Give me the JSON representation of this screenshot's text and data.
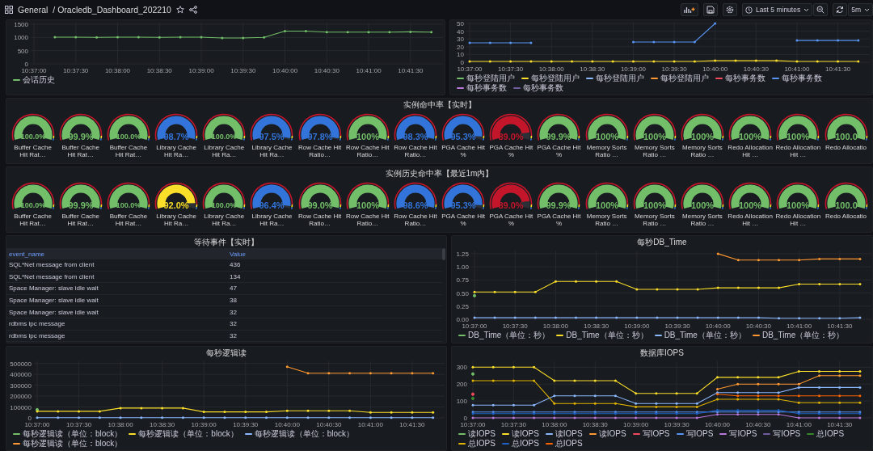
{
  "top_bar": {
    "folder": "General",
    "dashboard": "/ Oracledb_Dashboard_202210",
    "time_range": "Last 5 minutes",
    "refresh_interval": "5m"
  },
  "session_chart": {
    "chart_data": {
      "type": "line",
      "categories": [
        "10:37:00",
        null,
        "10:37:30",
        null,
        "10:38:00",
        null,
        "10:38:30",
        null,
        "10:39:00",
        null,
        "10:39:30",
        null,
        "10:40:00",
        null,
        "10:40:30",
        null,
        "10:41:00",
        null,
        "10:41:30",
        null
      ],
      "ylim": [
        0,
        1560
      ],
      "yticks": [
        0,
        500,
        1000,
        1500
      ],
      "grid": true,
      "legend": "bottom",
      "series": [
        {
          "name": "会话历史",
          "color": "#73bf69",
          "marker": true,
          "values": [
            null,
            1010,
            1010,
            1000,
            1010,
            1010,
            1000,
            1010,
            1010,
            980,
            980,
            1000,
            1240,
            1240,
            1200,
            1200,
            1200,
            1200,
            1210,
            1200
          ]
        }
      ]
    }
  },
  "rate_chart": {
    "chart_data": {
      "type": "line",
      "categories": [
        "10:37:00",
        null,
        "10:37:30",
        null,
        "10:38:00",
        null,
        "10:38:30",
        null,
        "10:39:00",
        null,
        "10:39:30",
        null,
        "10:40:00",
        null,
        "10:40:30",
        null,
        "10:41:00",
        null,
        "10:41:30",
        null
      ],
      "ylim": [
        0,
        51
      ],
      "yticks": [
        0,
        10,
        20,
        30,
        40,
        50
      ],
      "grid": true,
      "legend": "bottom",
      "series": [
        {
          "name": "每秒登陆用户",
          "color": "#73bf69",
          "marker": true,
          "values": [
            null,
            null,
            null,
            null,
            null,
            null,
            null,
            null,
            null,
            null,
            null,
            null,
            null,
            null,
            null,
            null,
            null,
            null,
            null,
            null
          ]
        },
        {
          "name": "每秒登陆用户",
          "color": "#fade2a",
          "marker": true,
          "values": [
            1,
            1,
            1,
            1,
            1,
            1,
            1,
            1,
            1,
            1,
            1,
            1,
            2,
            2,
            2,
            2,
            1,
            1,
            1,
            1
          ]
        },
        {
          "name": "每秒登陆用户",
          "color": "#8ab8ff",
          "marker": true,
          "values": [
            null,
            null,
            null,
            null,
            null,
            null,
            null,
            null,
            null,
            null,
            null,
            null,
            null,
            null,
            null,
            null,
            null,
            null,
            null,
            null
          ]
        },
        {
          "name": "每秒登陆用户",
          "color": "#ff9830",
          "marker": true,
          "values": [
            null,
            null,
            null,
            null,
            null,
            null,
            null,
            null,
            null,
            null,
            null,
            null,
            null,
            null,
            null,
            null,
            null,
            null,
            null,
            null
          ]
        },
        {
          "name": "每秒事务数",
          "color": "#f2495c",
          "marker": true,
          "values": [
            null,
            null,
            null,
            null,
            null,
            null,
            null,
            null,
            null,
            null,
            null,
            null,
            null,
            null,
            null,
            null,
            null,
            null,
            null,
            null
          ]
        },
        {
          "name": "每秒事务数",
          "color": "#5794f2",
          "marker": true,
          "values": [
            25,
            25,
            25,
            25,
            null,
            null,
            null,
            null,
            26,
            26,
            26,
            26,
            50,
            null,
            null,
            null,
            28,
            28,
            28,
            28
          ]
        },
        {
          "name": "每秒事务数",
          "color": "#b877d9",
          "marker": true,
          "values": [
            null,
            null,
            null,
            null,
            null,
            null,
            null,
            null,
            null,
            null,
            null,
            null,
            null,
            null,
            null,
            null,
            null,
            null,
            null,
            null
          ]
        },
        {
          "name": "每秒事务数",
          "color": "#705da0",
          "marker": true,
          "values": [
            null,
            null,
            null,
            null,
            null,
            null,
            null,
            null,
            null,
            null,
            null,
            null,
            null,
            null,
            null,
            null,
            null,
            null,
            null,
            null
          ]
        }
      ]
    }
  },
  "gauge_panels": [
    {
      "title": "实例命中率【实时】",
      "gauges": [
        {
          "label": "Buffer Cache Hit Rat…",
          "value": "100.0%",
          "color": "#73bf69"
        },
        {
          "label": "Buffer Cache Hit Rat…",
          "value": "99.9%",
          "color": "#73bf69"
        },
        {
          "label": "Buffer Cache Hit Rat…",
          "value": "100.0%",
          "color": "#73bf69"
        },
        {
          "label": "Library Cache Hit Ra…",
          "value": "98.7%",
          "color": "#3274d9"
        },
        {
          "label": "Library Cache Hit Ra…",
          "value": "100.0%",
          "color": "#73bf69"
        },
        {
          "label": "Library Cache Hit Ra…",
          "value": "97.5%",
          "color": "#3274d9"
        },
        {
          "label": "Row Cache Hit Ratio…",
          "value": "97.8%",
          "color": "#3274d9"
        },
        {
          "label": "Row Cache Hit Ratio…",
          "value": "100%",
          "color": "#73bf69"
        },
        {
          "label": "Row Cache Hit Ratio…",
          "value": "98.3%",
          "color": "#3274d9"
        },
        {
          "label": "PGA Cache Hit %",
          "value": "95.3%",
          "color": "#3274d9"
        },
        {
          "label": "PGA Cache Hit %",
          "value": "89.0%",
          "color": "#c4162a"
        },
        {
          "label": "PGA Cache Hit %",
          "value": "99.9%",
          "color": "#73bf69"
        },
        {
          "label": "Memory Sorts Ratio …",
          "value": "100%",
          "color": "#73bf69"
        },
        {
          "label": "Memory Sorts Ratio …",
          "value": "100%",
          "color": "#73bf69"
        },
        {
          "label": "Memory Sorts Ratio …",
          "value": "100%",
          "color": "#73bf69"
        },
        {
          "label": "Redo Allocation Hit …",
          "value": "100%",
          "color": "#73bf69"
        },
        {
          "label": "Redo Allocation Hit …",
          "value": "100%",
          "color": "#73bf69"
        },
        {
          "label": "Redo Allocatio",
          "value": "100.0",
          "color": "#73bf69"
        }
      ]
    },
    {
      "title": "实例历史命中率【最近1m内】",
      "gauges": [
        {
          "label": "Buffer Cache Hit Rat…",
          "value": "100.0%",
          "color": "#73bf69"
        },
        {
          "label": "Buffer Cache Hit Rat…",
          "value": "99.9%",
          "color": "#73bf69"
        },
        {
          "label": "Buffer Cache Hit Rat…",
          "value": "100.0%",
          "color": "#73bf69"
        },
        {
          "label": "Library Cache Hit Ra…",
          "value": "92.0%",
          "color": "#fade2a"
        },
        {
          "label": "Library Cache Hit Ra…",
          "value": "100.0%",
          "color": "#73bf69"
        },
        {
          "label": "Library Cache Hit Ra…",
          "value": "96.4%",
          "color": "#3274d9"
        },
        {
          "label": "Row Cache Hit Ratio…",
          "value": "99.0%",
          "color": "#73bf69"
        },
        {
          "label": "Row Cache Hit Ratio…",
          "value": "100%",
          "color": "#73bf69"
        },
        {
          "label": "Row Cache Hit Ratio…",
          "value": "98.6%",
          "color": "#3274d9"
        },
        {
          "label": "PGA Cache Hit %",
          "value": "95.3%",
          "color": "#3274d9"
        },
        {
          "label": "PGA Cache Hit %",
          "value": "89.0%",
          "color": "#c4162a"
        },
        {
          "label": "PGA Cache Hit %",
          "value": "99.9%",
          "color": "#73bf69"
        },
        {
          "label": "Memory Sorts Ratio …",
          "value": "100%",
          "color": "#73bf69"
        },
        {
          "label": "Memory Sorts Ratio …",
          "value": "100%",
          "color": "#73bf69"
        },
        {
          "label": "Memory Sorts Ratio …",
          "value": "100%",
          "color": "#73bf69"
        },
        {
          "label": "Redo Allocation Hit …",
          "value": "100%",
          "color": "#73bf69"
        },
        {
          "label": "Redo Allocation Hit …",
          "value": "100%",
          "color": "#73bf69"
        },
        {
          "label": "Redo Allocatio",
          "value": "100.0",
          "color": "#73bf69"
        }
      ]
    }
  ],
  "wait_events": {
    "title": "等待事件【实时】",
    "columns": [
      "event_name",
      "Value"
    ],
    "rows": [
      [
        "SQL*Net message from client",
        "436"
      ],
      [
        "SQL*Net message from client",
        "134"
      ],
      [
        "Space Manager: slave idle wait",
        "47"
      ],
      [
        "Space Manager: slave idle wait",
        "38"
      ],
      [
        "Space Manager: slave idle wait",
        "32"
      ],
      [
        "rdbms ipc message",
        "32"
      ],
      [
        "rdbms ipc message",
        "32"
      ]
    ]
  },
  "db_time": {
    "title": "每秒DB_Time",
    "chart_data": {
      "type": "line",
      "categories": [
        "10:37:00",
        null,
        "10:37:30",
        null,
        "10:38:00",
        null,
        "10:38:30",
        null,
        "10:39:00",
        null,
        "10:39:30",
        null,
        "10:40:00",
        null,
        "10:40:30",
        null,
        "10:41:00",
        null,
        "10:41:30",
        null
      ],
      "ylim": [
        0,
        1.31
      ],
      "yticks": [
        {
          "value": 0,
          "label": "0.00"
        },
        {
          "value": 0.25,
          "label": "0.25"
        },
        {
          "value": 0.5,
          "label": "0.50"
        },
        {
          "value": 0.75,
          "label": "0.75"
        },
        {
          "value": 1,
          "label": "1.00"
        },
        {
          "value": 1.25,
          "label": "1.25"
        }
      ],
      "grid": true,
      "legend": "bottom",
      "series": [
        {
          "name": "DB_Time（单位：秒）",
          "color": "#73bf69",
          "marker": true,
          "values": [
            0.45,
            null,
            null,
            null,
            null,
            null,
            null,
            null,
            null,
            null,
            null,
            null,
            null,
            null,
            null,
            null,
            null,
            null,
            null,
            null
          ]
        },
        {
          "name": "DB_Time（单位：秒）",
          "color": "#fade2a",
          "marker": true,
          "values": [
            0.52,
            0.52,
            0.52,
            0.52,
            0.72,
            0.72,
            0.72,
            0.72,
            0.57,
            0.57,
            0.57,
            0.57,
            0.6,
            0.6,
            0.6,
            0.6,
            0.67,
            0.67,
            0.67,
            0.67
          ]
        },
        {
          "name": "DB_Time（单位：秒）",
          "color": "#8ab8ff",
          "marker": true,
          "values": [
            0.03,
            0.03,
            0.03,
            0.03,
            0.03,
            0.03,
            0.03,
            0.03,
            0.03,
            0.03,
            0.03,
            0.03,
            0.03,
            0.03,
            0.03,
            0.02,
            0.02,
            0.02,
            0.02,
            0.03
          ]
        },
        {
          "name": "DB_Time（单位：秒）",
          "color": "#ff9830",
          "marker": true,
          "values": [
            null,
            null,
            null,
            null,
            null,
            null,
            null,
            null,
            null,
            null,
            null,
            null,
            1.25,
            1.13,
            1.13,
            1.13,
            1.13,
            1.15,
            1.15,
            1.15
          ]
        }
      ]
    }
  },
  "logical_reads": {
    "title": "每秒逻辑读",
    "chart_data": {
      "type": "line",
      "categories": [
        "10:37:00",
        null,
        "10:37:30",
        null,
        "10:38:00",
        null,
        "10:38:30",
        null,
        "10:39:00",
        null,
        "10:39:30",
        null,
        "10:40:00",
        null,
        "10:40:30",
        null,
        "10:41:00",
        null,
        "10:41:30",
        null
      ],
      "ylim": [
        0,
        520000
      ],
      "yticks": [
        0,
        100000,
        200000,
        300000,
        400000,
        500000
      ],
      "grid": true,
      "legend": "bottom",
      "series": [
        {
          "name": "每秒逻辑读（单位：block）",
          "color": "#73bf69",
          "marker": true,
          "values": [
            75000,
            null,
            null,
            null,
            null,
            null,
            null,
            null,
            null,
            null,
            null,
            null,
            null,
            null,
            null,
            null,
            null,
            null,
            null,
            null
          ]
        },
        {
          "name": "每秒逻辑读（单位：block）",
          "color": "#fade2a",
          "marker": true,
          "values": [
            60000,
            60000,
            60000,
            60000,
            90000,
            90000,
            90000,
            90000,
            55000,
            55000,
            55000,
            55000,
            65000,
            65000,
            65000,
            65000,
            50000,
            50000,
            50000,
            50000
          ]
        },
        {
          "name": "每秒逻辑读（单位：block）",
          "color": "#8ab8ff",
          "marker": true,
          "values": [
            2000,
            2000,
            2000,
            2000,
            2000,
            2000,
            2000,
            2000,
            2000,
            2000,
            2000,
            2000,
            2000,
            2000,
            2000,
            2000,
            2000,
            2000,
            2000,
            2000
          ]
        },
        {
          "name": "每秒逻辑读（单位：block）",
          "color": "#ff9830",
          "marker": true,
          "values": [
            null,
            null,
            null,
            null,
            null,
            null,
            null,
            null,
            null,
            null,
            null,
            null,
            470000,
            410000,
            410000,
            410000,
            410000,
            410000,
            410000,
            410000
          ]
        }
      ]
    }
  },
  "iops": {
    "title": "数据库IOPS",
    "chart_data": {
      "type": "line",
      "categories": [
        "10:37:00",
        null,
        "10:37:30",
        null,
        "10:38:00",
        null,
        "10:38:30",
        null,
        "10:39:00",
        null,
        "10:39:30",
        null,
        "10:40:00",
        null,
        "10:40:30",
        null,
        "10:41:00",
        null,
        "10:41:30",
        null
      ],
      "ylim": [
        0,
        335
      ],
      "yticks": [
        0,
        100,
        200,
        300
      ],
      "grid": true,
      "legend": "bottom",
      "series": [
        {
          "name": "读IOPS",
          "color": "#73bf69",
          "marker": true,
          "values": [
            260,
            null,
            null,
            null,
            null,
            null,
            null,
            null,
            null,
            null,
            null,
            null,
            null,
            null,
            null,
            null,
            null,
            null,
            null,
            null
          ]
        },
        {
          "name": "读IOPS",
          "color": "#fade2a",
          "marker": true,
          "values": [
            300,
            300,
            300,
            300,
            220,
            220,
            220,
            220,
            145,
            145,
            145,
            145,
            240,
            240,
            240,
            240,
            275,
            275,
            275,
            275
          ]
        },
        {
          "name": "读IOPS",
          "color": "#8ab8ff",
          "marker": true,
          "values": [
            75,
            75,
            75,
            75,
            130,
            130,
            130,
            130,
            85,
            85,
            85,
            85,
            150,
            150,
            150,
            150,
            180,
            180,
            180,
            180
          ]
        },
        {
          "name": "读IOPS",
          "color": "#ff9830",
          "marker": true,
          "values": [
            null,
            null,
            null,
            null,
            null,
            null,
            null,
            null,
            null,
            null,
            null,
            null,
            170,
            200,
            200,
            200,
            200,
            250,
            250,
            250
          ]
        },
        {
          "name": "写IOPS",
          "color": "#f2495c",
          "marker": true,
          "values": [
            140,
            null,
            null,
            null,
            null,
            null,
            null,
            null,
            null,
            null,
            null,
            null,
            null,
            null,
            null,
            null,
            null,
            null,
            null,
            null
          ]
        },
        {
          "name": "写IOPS",
          "color": "#5794f2",
          "marker": true,
          "values": [
            35,
            35,
            35,
            35,
            35,
            35,
            35,
            35,
            35,
            35,
            35,
            35,
            35,
            35,
            35,
            35,
            35,
            35,
            35,
            35
          ]
        },
        {
          "name": "写IOPS",
          "color": "#b877d9",
          "marker": true,
          "values": [
            0,
            0,
            0,
            0,
            0,
            0,
            0,
            0,
            0,
            0,
            0,
            0,
            20,
            20,
            20,
            20,
            0,
            0,
            0,
            0
          ]
        },
        {
          "name": "写IOPS",
          "color": "#705da0",
          "marker": true,
          "values": [
            null,
            null,
            null,
            null,
            null,
            null,
            null,
            null,
            null,
            null,
            null,
            null,
            null,
            null,
            null,
            null,
            null,
            null,
            null,
            null
          ]
        },
        {
          "name": "总IOPS",
          "color": "#37872d",
          "marker": true,
          "values": [
            115,
            null,
            null,
            null,
            null,
            null,
            null,
            null,
            null,
            null,
            null,
            null,
            null,
            null,
            null,
            null,
            null,
            null,
            null,
            null
          ]
        },
        {
          "name": "总IOPS",
          "color": "#e0b400",
          "marker": true,
          "values": [
            220,
            220,
            220,
            220,
            85,
            85,
            85,
            85,
            65,
            65,
            65,
            65,
            110,
            110,
            110,
            110,
            90,
            90,
            90,
            90
          ]
        },
        {
          "name": "总IOPS",
          "color": "#1f60c4",
          "marker": true,
          "values": [
            25,
            25,
            25,
            25,
            25,
            25,
            25,
            25,
            25,
            25,
            25,
            25,
            45,
            45,
            45,
            45,
            25,
            25,
            25,
            25
          ]
        },
        {
          "name": "总IOPS",
          "color": "#fa6400",
          "marker": true,
          "values": [
            null,
            null,
            null,
            null,
            null,
            null,
            null,
            null,
            null,
            null,
            null,
            null,
            140,
            130,
            130,
            130,
            130,
            130,
            130,
            130
          ]
        }
      ]
    }
  }
}
